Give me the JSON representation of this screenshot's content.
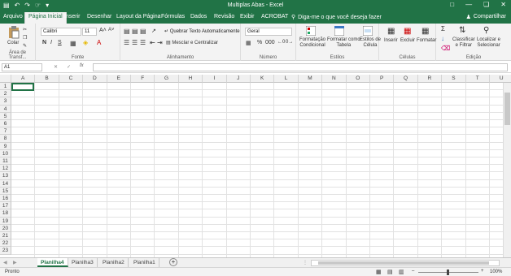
{
  "window": {
    "title": "Multiplas Abas  -  Excel",
    "minimize": "—",
    "restore": "❏",
    "close": "✕"
  },
  "tabs": [
    "Arquivo",
    "Página Inicial",
    "Inserir",
    "Desenhar",
    "Layout da Página",
    "Fórmulas",
    "Dados",
    "Revisão",
    "Exibir",
    "ACROBAT"
  ],
  "tellme": "Diga-me o que você deseja fazer",
  "share": "Compartilhar",
  "ribbon": {
    "clipboard": {
      "paste": "Colar",
      "label": "Área de Transf..."
    },
    "font": {
      "name": "Calibri",
      "size": "11",
      "bold": "N",
      "italic": "I",
      "underline": "S",
      "label": "Fonte"
    },
    "alignment": {
      "wrap": "Quebrar Texto Automaticamente",
      "merge": "Mesclar e Centralizar",
      "label": "Alinhamento"
    },
    "number": {
      "format": "Geral",
      "label": "Número"
    },
    "styles": {
      "conditional": "Formatação\nCondicional",
      "table": "Formatar como\nTabela",
      "cell": "Estilos de\nCélula",
      "label": "Estilos"
    },
    "cells": {
      "insert": "Inserir",
      "delete": "Excluir",
      "format": "Formatar",
      "label": "Células"
    },
    "editing": {
      "sort": "Classificar\ne Filtrar",
      "find": "Localizar e\nSelecionar",
      "label": "Edição"
    }
  },
  "formula": {
    "namebox": "A1",
    "fx": "fx",
    "value": ""
  },
  "columns": [
    "A",
    "B",
    "C",
    "D",
    "E",
    "F",
    "G",
    "H",
    "I",
    "J",
    "K",
    "L",
    "M",
    "N",
    "O",
    "P",
    "Q",
    "R",
    "S",
    "T",
    "U"
  ],
  "rows": [
    "1",
    "2",
    "3",
    "4",
    "5",
    "6",
    "7",
    "8",
    "9",
    "10",
    "11",
    "12",
    "13",
    "14",
    "15",
    "16",
    "17",
    "18",
    "19",
    "20",
    "21",
    "22",
    "23"
  ],
  "sheets": [
    "Planilha4",
    "Planilha3",
    "Planilha2",
    "Planilha1"
  ],
  "add_sheet": "+",
  "status": {
    "left": "Pronto",
    "zoom": "100%"
  },
  "colors": {
    "accent": "#217346"
  }
}
